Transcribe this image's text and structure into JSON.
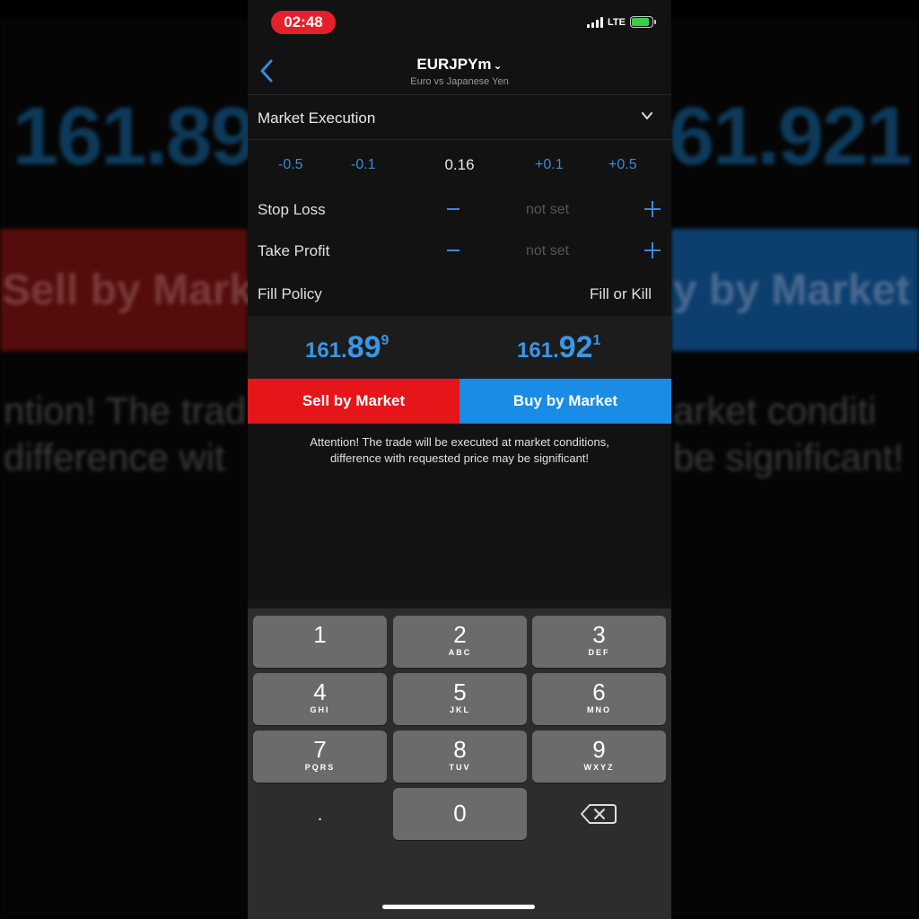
{
  "status": {
    "time": "02:48",
    "network": "LTE",
    "battery": ""
  },
  "nav": {
    "symbol": "EURJPYm",
    "description": "Euro vs Japanese Yen"
  },
  "execution": {
    "label": "Market Execution"
  },
  "volume": {
    "minus_05": "-0.5",
    "minus_01": "-0.1",
    "value": "0.16",
    "plus_01": "+0.1",
    "plus_05": "+0.5"
  },
  "stop_loss": {
    "label": "Stop Loss",
    "value": "not set"
  },
  "take_profit": {
    "label": "Take Profit",
    "value": "not set"
  },
  "fill_policy": {
    "label": "Fill Policy",
    "value": "Fill or Kill"
  },
  "prices": {
    "bid": {
      "small": "161.",
      "big": "89",
      "sup": "9"
    },
    "ask": {
      "small": "161.",
      "big": "92",
      "sup": "1"
    }
  },
  "buttons": {
    "sell": "Sell by Market",
    "buy": "Buy by Market"
  },
  "attention": {
    "line1": "Attention! The trade will be executed at market conditions,",
    "line2": "difference with requested price may be significant!"
  },
  "background": {
    "bid_text": "161.89",
    "ask_text": "61.921",
    "sell_text": "Sell by Mark",
    "buy_text": "y by Market",
    "left_line1": "ntion! The trad",
    "left_line2": "difference wit",
    "right_line1": "arket conditi",
    "right_line2": "be significant!"
  },
  "keypad": {
    "keys": [
      {
        "digit": "1",
        "letters": ""
      },
      {
        "digit": "2",
        "letters": "ABC"
      },
      {
        "digit": "3",
        "letters": "DEF"
      },
      {
        "digit": "4",
        "letters": "GHI"
      },
      {
        "digit": "5",
        "letters": "JKL"
      },
      {
        "digit": "6",
        "letters": "MNO"
      },
      {
        "digit": "7",
        "letters": "PQRS"
      },
      {
        "digit": "8",
        "letters": "TUV"
      },
      {
        "digit": "9",
        "letters": "WXYZ"
      }
    ],
    "decimal": ".",
    "zero": "0"
  },
  "colors": {
    "sell": "#e5151a",
    "buy": "#1a8ce6",
    "price": "#3a96e6",
    "time_pill": "#e5202a",
    "accent": "#3a8ad8"
  }
}
